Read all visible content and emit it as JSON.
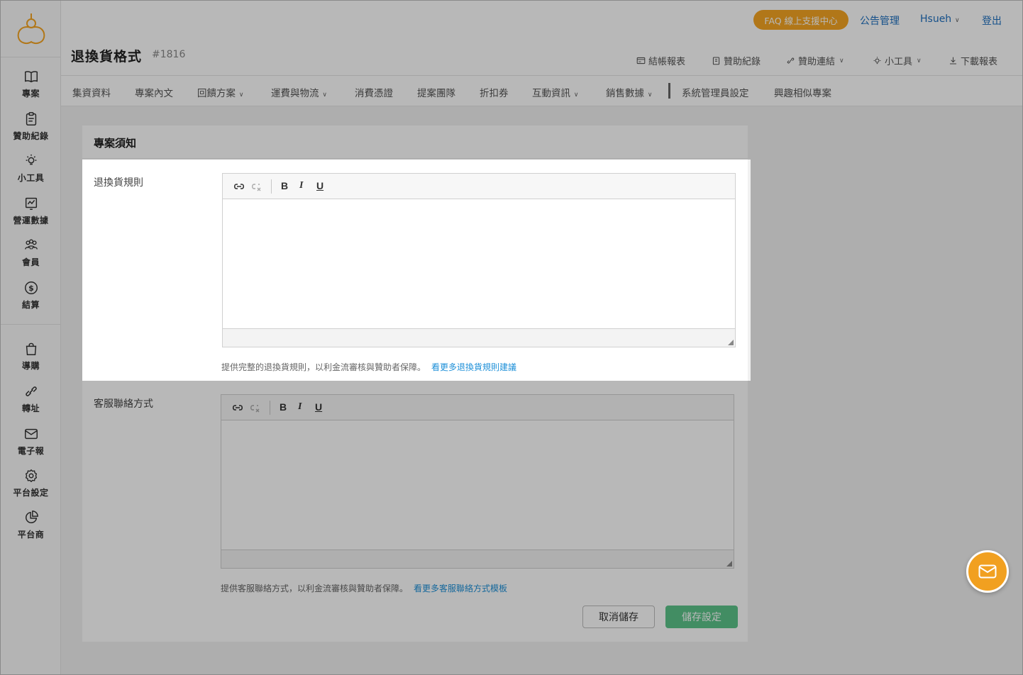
{
  "sidebar": {
    "items": [
      {
        "label": "專案",
        "icon": "book-icon"
      },
      {
        "label": "贊助紀錄",
        "icon": "clipboard-icon"
      },
      {
        "label": "小工具",
        "icon": "lightbulb-icon"
      },
      {
        "label": "營運數據",
        "icon": "chart-icon"
      },
      {
        "label": "會員",
        "icon": "users-icon"
      },
      {
        "label": "結算",
        "icon": "dollar-icon"
      },
      {
        "label": "導購",
        "icon": "bag-icon"
      },
      {
        "label": "轉址",
        "icon": "link-icon"
      },
      {
        "label": "電子報",
        "icon": "mail-icon"
      },
      {
        "label": "平台設定",
        "icon": "gear-icon"
      },
      {
        "label": "平台商",
        "icon": "pie-icon"
      }
    ]
  },
  "header": {
    "faq": "FAQ 線上支援中心",
    "announce": "公告管理",
    "user": "Hsueh",
    "logout": "登出",
    "title": "退換貨格式",
    "project_id": "#1816",
    "tools": {
      "settlement": "結帳報表",
      "sponsor_records": "贊助紀錄",
      "sponsor_link": "贊助連結",
      "widgets": "小工具",
      "download": "下載報表"
    }
  },
  "tabs": [
    "集資資料",
    "專案內文",
    "回饋方案",
    "運費與物流",
    "消費憑證",
    "提案團隊",
    "折扣券",
    "互動資訊",
    "銷售數據",
    "系統管理員設定",
    "興趣相似專案"
  ],
  "card": {
    "title": "專案須知",
    "return_rules": {
      "label": "退換貨規則",
      "help": "提供完整的退換貨規則，以利金流審核與贊助者保障。",
      "link": "看更多退換貨規則建議"
    },
    "contact": {
      "label": "客服聯絡方式",
      "help": "提供客服聯絡方式，以利金流審核與贊助者保障。",
      "link": "看更多客服聯絡方式模板"
    },
    "toolbar": {
      "bold": "B",
      "italic": "I",
      "underline": "U"
    },
    "cancel": "取消儲存",
    "save": "儲存設定"
  },
  "colors": {
    "accent_orange": "#f5a623",
    "save_green": "#5cc48a",
    "link_blue": "#1e90d8"
  }
}
